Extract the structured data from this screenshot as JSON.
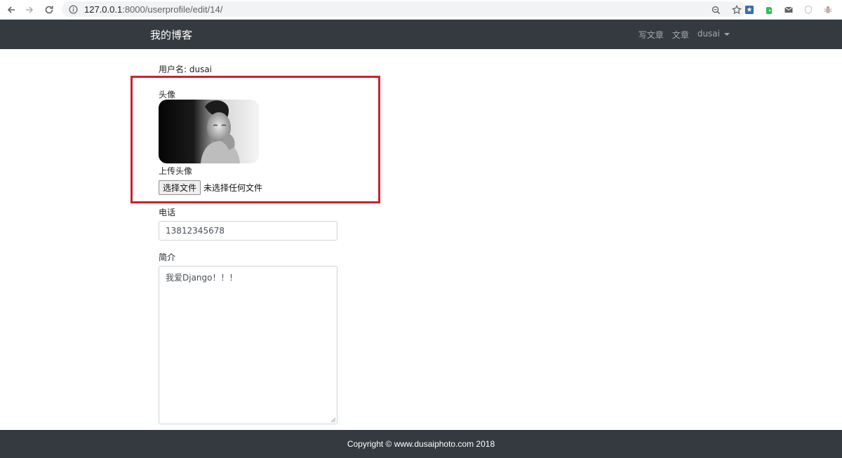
{
  "browser": {
    "url_host": "127.0.0.1",
    "url_path": ":8000/userprofile/edit/14/"
  },
  "navbar": {
    "brand": "我的博客",
    "links": {
      "write": "写文章",
      "articles": "文章",
      "user": "dusai"
    }
  },
  "form": {
    "username": "用户名: dusai",
    "avatar_label": "头像",
    "upload_label": "上传头像",
    "file_button": "选择文件",
    "file_status": "未选择任何文件",
    "phone_label": "电话",
    "phone_value": "13812345678",
    "bio_label": "简介",
    "bio_value": "我爱Django！！！"
  },
  "footer": {
    "copyright": "Copyright © www.dusaiphoto.com 2018"
  },
  "colors": {
    "navbar_bg": "#343a40",
    "highlight": "#d0202a"
  },
  "icons": {
    "back": "arrow-left-icon",
    "forward": "arrow-right-icon",
    "reload": "reload-icon",
    "info": "info-icon",
    "zoom": "zoom-icon",
    "star": "star-icon"
  }
}
